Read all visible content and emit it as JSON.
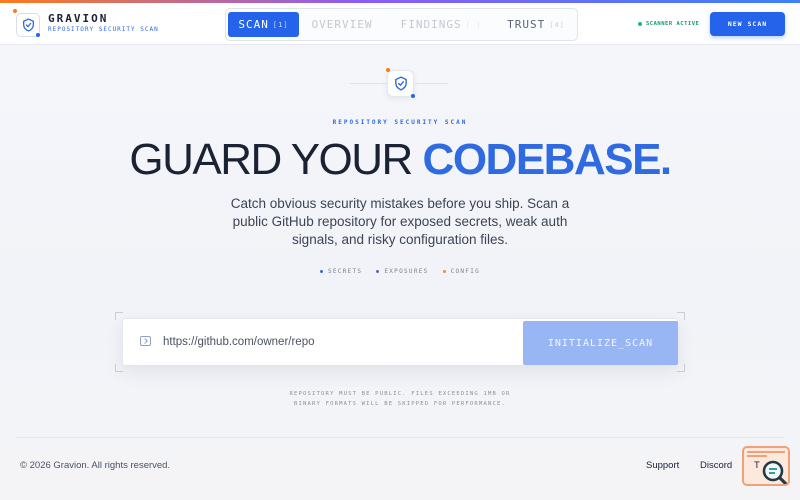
{
  "brand": {
    "name": "GRAVION",
    "subtitle": "REPOSITORY SECURITY SCAN",
    "logo_icon": "shield-check-icon"
  },
  "nav": {
    "tabs": [
      {
        "label": "SCAN",
        "index": "[1]",
        "active": true
      },
      {
        "label": "OVERVIEW",
        "index": "",
        "active": false
      },
      {
        "label": "FINDINGS",
        "index": "",
        "active": false
      },
      {
        "label": "TRUST",
        "index": "[4]",
        "active": false
      }
    ]
  },
  "status": {
    "label": "SCANNER ACTIVE",
    "color": "#12b886"
  },
  "header_button": {
    "label": "NEW SCAN"
  },
  "hero": {
    "icon": "shield-check-icon",
    "eyebrow": "REPOSITORY SECURITY SCAN",
    "headline_plain": "GUARD YOUR ",
    "headline_accent": "CODEBASE.",
    "lede": "Catch obvious security mistakes before you ship. Scan a public GitHub repository for exposed secrets, weak auth signals, and risky configuration files.",
    "tags": [
      {
        "label": "SECRETS",
        "color": "#2f6ae0"
      },
      {
        "label": "EXPOSURES",
        "color": "#6d5bd0"
      },
      {
        "label": "CONFIG",
        "color": "#f08a3c"
      }
    ]
  },
  "scan": {
    "icon": "terminal-icon",
    "placeholder": "https://github.com/owner/repo",
    "button_label": "INITIALIZE_SCAN",
    "disclaimer_line1": "REPOSITORY MUST BE PUBLIC. FILES EXCEEDING 1MB OR",
    "disclaimer_line2": "BINARY FORMATS WILL BE SKIPPED FOR PERFORMANCE."
  },
  "footer": {
    "copyright": "© 2026 Gravion. All rights reserved.",
    "links": [
      "Support",
      "Discord",
      "T"
    ]
  },
  "colors": {
    "accent": "#2563eb",
    "accent_text": "#2f6ae0",
    "button_disabled": "#99b6f4",
    "orange": "#ff7a1a"
  }
}
